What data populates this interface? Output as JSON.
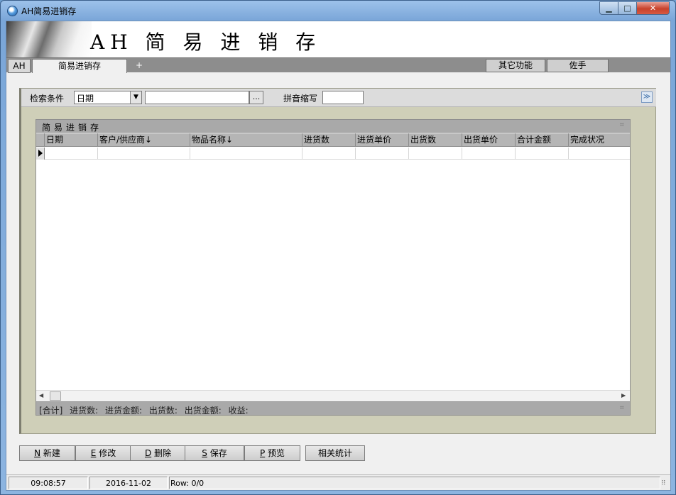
{
  "window": {
    "title": "AH简易进销存",
    "min_glyph": "▁",
    "max_glyph": "□",
    "close_glyph": "✕"
  },
  "banner": {
    "title": "AH 简 易 进 销 存"
  },
  "tabs": [
    {
      "label": "AH"
    },
    {
      "label": "简易进销存"
    },
    {
      "label": "+"
    }
  ],
  "toolbar_right": {
    "other_label": "其它功能",
    "helper_label": "佐手"
  },
  "search": {
    "condition_label": "检索条件",
    "field_value": "日期",
    "dropdown_glyph": "▼",
    "keyword_value": "",
    "ellipsis_label": "...",
    "pinyin_label": "拼音缩写",
    "pinyin_value": "",
    "collapse_glyph": "≫"
  },
  "grid": {
    "caption": "简易进销存",
    "pin_glyph": "⌗",
    "columns": [
      "日期",
      "客户/供应商↓",
      "物品名称↓",
      "进货数",
      "进货单价",
      "出货数",
      "出货单价",
      "合计金额",
      "完成状况"
    ],
    "footer": "[合计] 进货数:  进货金额:  出货数:  出货金额:  收益:",
    "scroll_left": "◀",
    "scroll_right": "▶"
  },
  "actions": {
    "new_key": "N",
    "new_label": "新建",
    "edit_key": "E",
    "edit_label": "修改",
    "delete_key": "D",
    "delete_label": "删除",
    "save_key": "S",
    "save_label": "保存",
    "preview_key": "P",
    "preview_label": "预览",
    "stats_label": "相关统计"
  },
  "status": {
    "time": "09:08:57",
    "date": "2016-11-02",
    "row": "Row: 0/0",
    "grip": "⠿"
  },
  "colors": {
    "panel_bg": "#cfcfb8",
    "grid_header": "#b5b5b5",
    "tabstrip": "#8d8d8d",
    "titlebar": "#7aa6d8"
  }
}
